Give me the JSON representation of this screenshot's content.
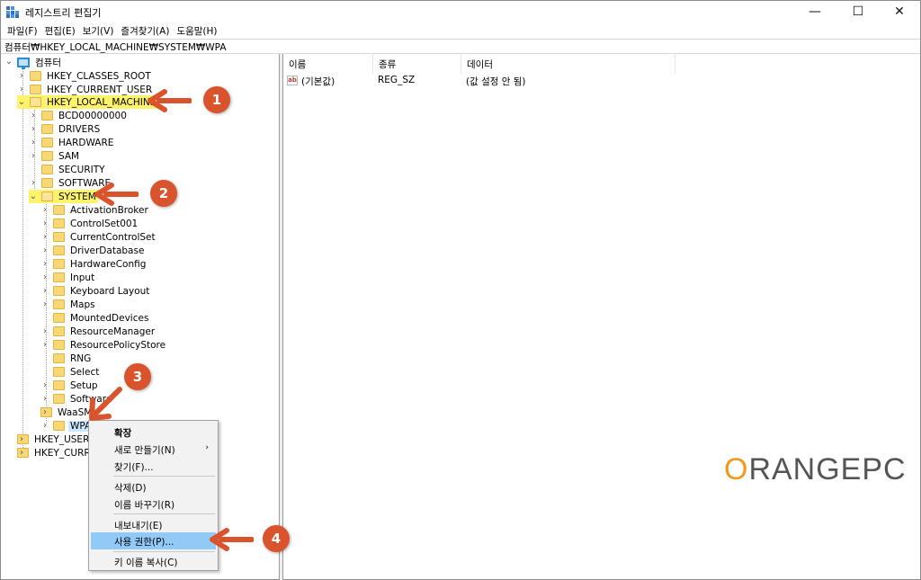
{
  "window": {
    "title": "레지스트리 편집기",
    "controls": {
      "minimize": "—",
      "maximize": "☐",
      "close": "✕"
    }
  },
  "menu": [
    "파일(F)",
    "편집(E)",
    "보기(V)",
    "즐겨찾기(A)",
    "도움말(H)"
  ],
  "address": "컴퓨터₩HKEY_LOCAL_MACHINE₩SYSTEM₩WPA",
  "tree": {
    "root": "컴퓨터",
    "hives": {
      "classes_root": "HKEY_CLASSES_ROOT",
      "current_user": "HKEY_CURRENT_USER",
      "local_machine": "HKEY_LOCAL_MACHINE",
      "users": "HKEY_USERS",
      "current_config": "HKEY_CURRENT_CONFIG"
    },
    "hklm_children": [
      "BCD00000000",
      "DRIVERS",
      "HARDWARE",
      "SAM",
      "SECURITY",
      "SOFTWARE",
      "SYSTEM"
    ],
    "system_children": [
      "ActivationBroker",
      "ControlSet001",
      "CurrentControlSet",
      "DriverDatabase",
      "HardwareConfig",
      "Input",
      "Keyboard Layout",
      "Maps",
      "MountedDevices",
      "ResourceManager",
      "ResourcePolicyStore",
      "RNG",
      "Select",
      "Setup",
      "Software",
      "WaaSMedic",
      "WPA"
    ]
  },
  "list": {
    "columns": [
      "이름",
      "종류",
      "데이터"
    ],
    "rows": [
      {
        "name": "(기본값)",
        "type": "REG_SZ",
        "data": "(값 설정 안 됨)"
      }
    ],
    "value_icon": "ab"
  },
  "context_menu": {
    "expand": "확장",
    "new": "새로 만들기(N)",
    "find": "찾기(F)...",
    "delete": "삭제(D)",
    "rename": "이름 바꾸기(R)",
    "export": "내보내기(E)",
    "permissions": "사용 권한(P)...",
    "copy_key_name": "키 이름 복사(C)"
  },
  "annotations": [
    "1",
    "2",
    "3",
    "4"
  ],
  "colors": {
    "annotation": "#d9532c",
    "highlight": "#fff36b",
    "menu_hover": "#91c9f7",
    "logo_orange": "#f29a1f",
    "logo_gray": "#555555"
  },
  "logo": {
    "first_letter": "O",
    "rest": "RANGEPC"
  }
}
